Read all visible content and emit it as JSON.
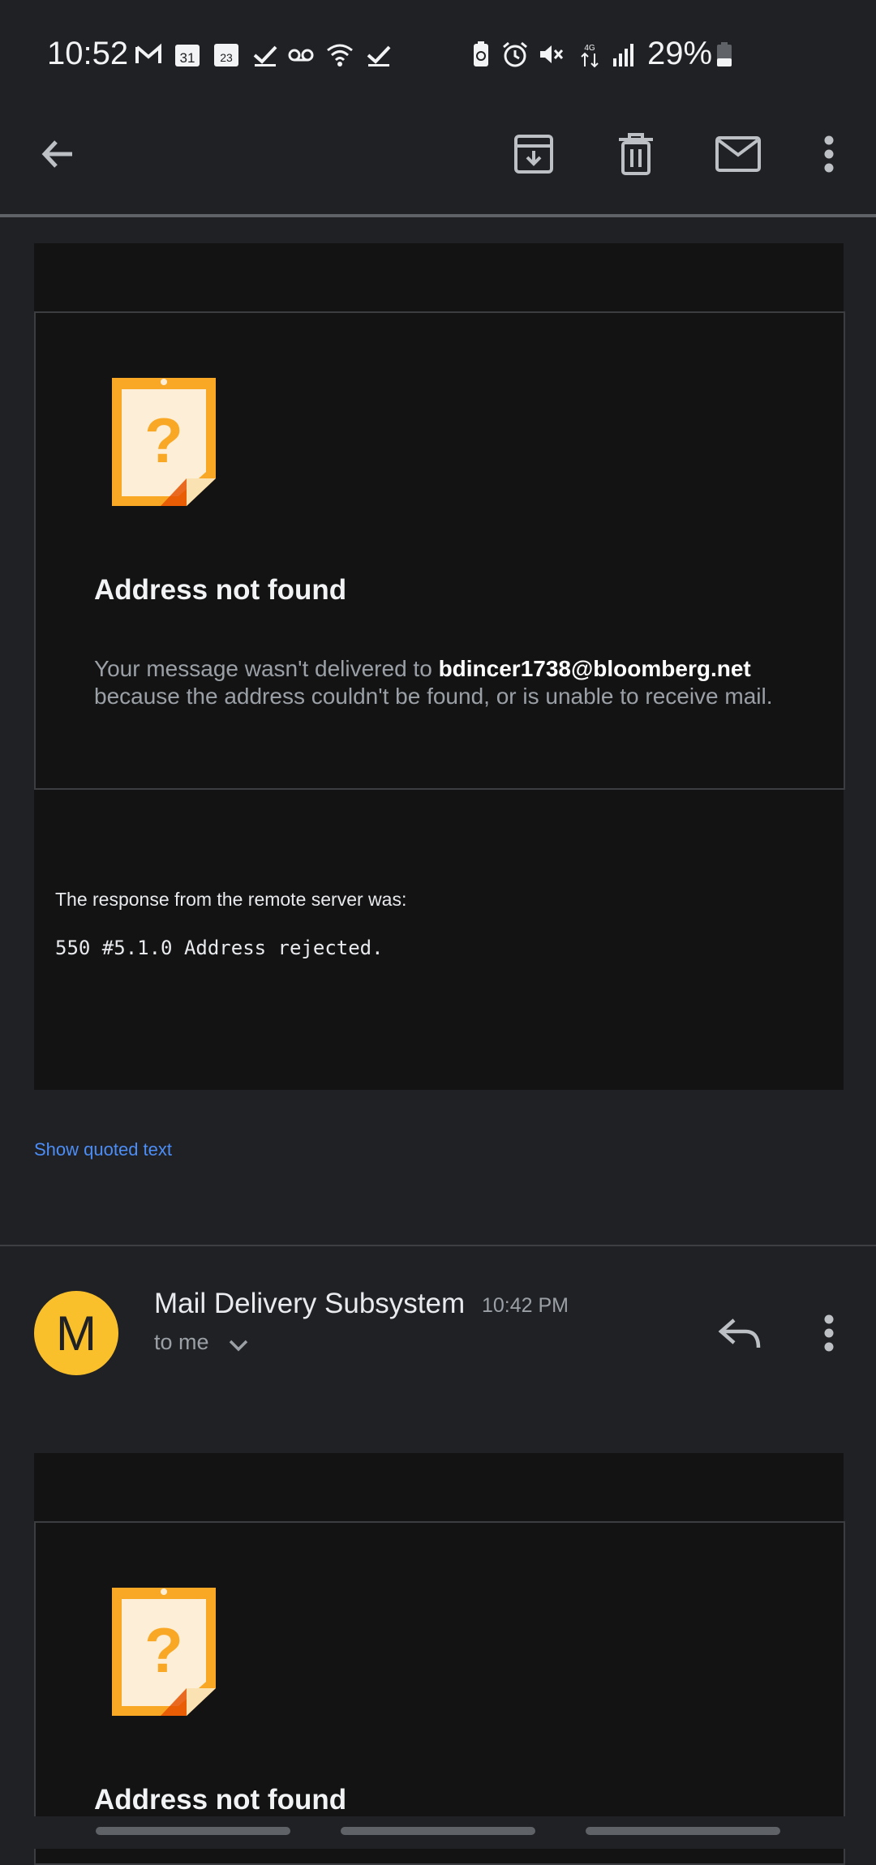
{
  "status_bar": {
    "time": "10:52",
    "battery_percent": "29%",
    "left_icons": [
      "gmail-icon",
      "calendar-icon",
      "calendar-day-icon",
      "check-icon",
      "voicemail-icon",
      "wifi-icon",
      "check-icon"
    ],
    "right_icons": [
      "battery-saver-icon",
      "alarm-icon",
      "mute-icon",
      "data-icon",
      "signal-icon",
      "battery-icon"
    ],
    "calendar_day_1": "31",
    "calendar_day_2": "23",
    "data_badge": "4G"
  },
  "toolbar": {
    "back": "back-arrow-icon",
    "actions": [
      "archive-icon",
      "delete-icon",
      "mark-unread-icon",
      "more-vert-icon"
    ]
  },
  "messages": [
    {
      "title": "Address not found",
      "body_prefix": "Your message wasn't delivered to ",
      "address": "bdincer1738@bloomberg.net",
      "body_suffix": "because the address couldn't be found, or is unable to receive mail.",
      "remote_intro": "The response from the remote server was:",
      "remote_code": "550 #5.1.0 Address rejected.",
      "show_quoted": "Show quoted text"
    },
    {
      "sender_initial": "M",
      "sender_name": "Mail Delivery Subsystem",
      "time": "10:42 PM",
      "recipient": "to me",
      "title": "Address not found"
    }
  ],
  "colors": {
    "background": "#202124",
    "card": "#131314",
    "link": "#4c8df6",
    "avatar": "#f9c02c",
    "warning_icon": "#f9a825"
  }
}
